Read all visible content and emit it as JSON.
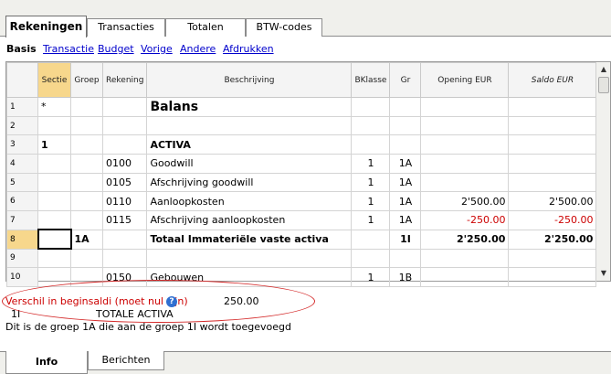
{
  "top_tabs": [
    {
      "label": "Rekeningen",
      "active": true
    },
    {
      "label": "Transacties",
      "active": false
    },
    {
      "label": "Totalen",
      "active": false
    },
    {
      "label": "BTW-codes",
      "active": false
    }
  ],
  "views": {
    "active": "Basis",
    "links": [
      "Transactie",
      "Budget",
      "Vorige",
      "Andere",
      "Afdrukken"
    ]
  },
  "table": {
    "headers": [
      "Sectie",
      "Groep",
      "Rekening",
      "Beschrijving",
      "BKlasse",
      "Gr",
      "Opening EUR",
      "Saldo EUR"
    ],
    "rows": [
      {
        "n": "1",
        "sectie": "*",
        "groep": "",
        "rekening": "",
        "beschrijving": "Balans",
        "bklasse": "",
        "gr": "",
        "opening": "",
        "saldo": ""
      },
      {
        "n": "2",
        "sectie": "",
        "groep": "",
        "rekening": "",
        "beschrijving": "",
        "bklasse": "",
        "gr": "",
        "opening": "",
        "saldo": ""
      },
      {
        "n": "3",
        "sectie": "1",
        "groep": "",
        "rekening": "",
        "beschrijving": "ACTIVA",
        "bklasse": "",
        "gr": "",
        "opening": "",
        "saldo": ""
      },
      {
        "n": "4",
        "sectie": "",
        "groep": "",
        "rekening": "0100",
        "beschrijving": "Goodwill",
        "bklasse": "1",
        "gr": "1A",
        "opening": "",
        "saldo": ""
      },
      {
        "n": "5",
        "sectie": "",
        "groep": "",
        "rekening": "0105",
        "beschrijving": "Afschrijving goodwill",
        "bklasse": "1",
        "gr": "1A",
        "opening": "",
        "saldo": ""
      },
      {
        "n": "6",
        "sectie": "",
        "groep": "",
        "rekening": "0110",
        "beschrijving": "Aanloopkosten",
        "bklasse": "1",
        "gr": "1A",
        "opening": "2'500.00",
        "saldo": "2'500.00"
      },
      {
        "n": "7",
        "sectie": "",
        "groep": "",
        "rekening": "0115",
        "beschrijving": "Afschrijving aanloopkosten",
        "bklasse": "1",
        "gr": "1A",
        "opening": "-250.00",
        "saldo": "-250.00"
      },
      {
        "n": "8",
        "sectie": "",
        "groep": "1A",
        "rekening": "",
        "beschrijving": "Totaal Immateriële vaste activa",
        "bklasse": "",
        "gr": "1I",
        "opening": "2'250.00",
        "saldo": "2'250.00"
      },
      {
        "n": "9",
        "sectie": "",
        "groep": "",
        "rekening": "",
        "beschrijving": "",
        "bklasse": "",
        "gr": "",
        "opening": "",
        "saldo": ""
      },
      {
        "n": "10",
        "sectie": "",
        "groep": "",
        "rekening": "0150",
        "beschrijving": "Gebouwen",
        "bklasse": "1",
        "gr": "1B",
        "opening": "",
        "saldo": ""
      }
    ]
  },
  "info": {
    "line1_label": "Verschil in beginsaldi (moet nul zijn)",
    "line1_value": "250.00",
    "line2_code": "1I",
    "line2_text": "TOTALE ACTIVA",
    "line3": "Dit is de groep 1A die aan de groep 1I wordt toegevoegd",
    "help_glyph": "?"
  },
  "bottom_tabs": [
    {
      "label": "Info",
      "active": true
    },
    {
      "label": "Berichten",
      "active": false
    }
  ],
  "colors": {
    "accent_header": "#f7d78c",
    "negative": "#cc0000",
    "link": "#0000cc",
    "error_text": "#cc0000",
    "annotation": "#d42a2a"
  }
}
